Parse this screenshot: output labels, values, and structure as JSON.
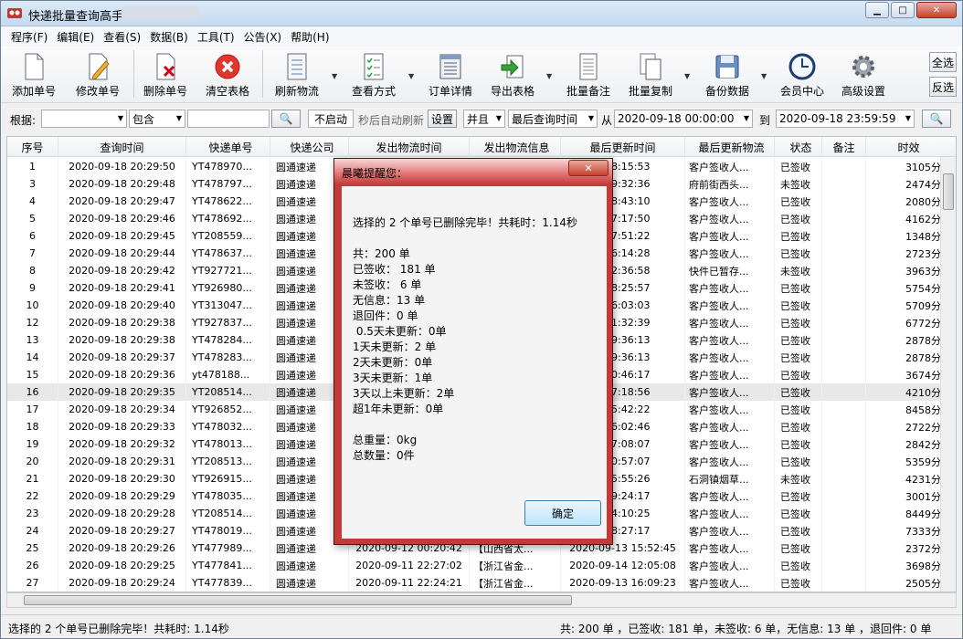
{
  "window": {
    "title": "快递批量查询高手"
  },
  "menu": [
    "程序(F)",
    "编辑(E)",
    "查看(S)",
    "数据(B)",
    "工具(T)",
    "公告(X)",
    "帮助(H)"
  ],
  "toolbar": {
    "add": "添加单号",
    "edit": "修改单号",
    "delete": "删除单号",
    "clear": "清空表格",
    "refresh": "刷新物流",
    "view_mode": "查看方式",
    "order_detail": "订单详情",
    "export": "导出表格",
    "batch_note": "批量备注",
    "batch_copy": "批量复制",
    "backup": "备份数据",
    "member": "会员中心",
    "advanced": "高级设置",
    "select_all": "全选",
    "invert": "反选"
  },
  "filter": {
    "by_label": "根据:",
    "by_value": "",
    "match": "包含",
    "keyword": "",
    "not_started": "不启动",
    "auto_refresh": "秒后自动刷新",
    "set": "设置",
    "logic": "并且",
    "time_field": "最后查询时间",
    "from_label": "从",
    "from": "2020-09-18 00:00:00",
    "to_label": "到",
    "to": "2020-09-18 23:59:59"
  },
  "table": {
    "headers": [
      "序号",
      "查询时间",
      "快递单号",
      "快递公司",
      "发出物流时间",
      "发出物流信息",
      "最后更新时间",
      "最后更新物流",
      "状态",
      "备注",
      "时效"
    ],
    "rows": [
      [
        "1",
        "2020-09-18 20:29:50",
        "YT478970...",
        "圆通速递",
        "",
        "",
        "8 18:15:53",
        "客户签收人...",
        "已签收",
        "",
        "3105分钟"
      ],
      [
        "3",
        "2020-09-18 20:29:48",
        "YT478797...",
        "圆通速递",
        "",
        "",
        "7 09:32:36",
        "府前街西头...",
        "未签收",
        "",
        "2474分钟"
      ],
      [
        "4",
        "2020-09-18 20:29:47",
        "YT478622...",
        "圆通速递",
        "",
        "",
        "6 08:43:10",
        "客户签收人...",
        "已签收",
        "",
        "2080分钟"
      ],
      [
        "5",
        "2020-09-18 20:29:46",
        "YT478692...",
        "圆通速递",
        "",
        "",
        "7 17:17:50",
        "客户签收人...",
        "已签收",
        "",
        "4162分钟"
      ],
      [
        "6",
        "2020-09-18 20:29:45",
        "YT208559...",
        "圆通速递",
        "",
        "",
        "5 17:51:22",
        "客户签收人...",
        "已签收",
        "",
        "1348分钟"
      ],
      [
        "7",
        "2020-09-18 20:29:44",
        "YT478637...",
        "圆通速递",
        "",
        "",
        "6 16:14:28",
        "客户签收人...",
        "已签收",
        "",
        "2723分钟"
      ],
      [
        "8",
        "2020-09-18 20:29:42",
        "YT927721...",
        "圆通速递",
        "",
        "",
        "7 12:36:58",
        "快件已暂存...",
        "未签收",
        "",
        "3963分钟"
      ],
      [
        "9",
        "2020-09-18 20:29:41",
        "YT926980...",
        "圆通速递",
        "",
        "",
        "8 18:25:57",
        "客户签收人...",
        "已签收",
        "",
        "5754分钟"
      ],
      [
        "10",
        "2020-09-18 20:29:40",
        "YT313047...",
        "圆通速递",
        "",
        "",
        "8 16:03:03",
        "客户签收人...",
        "已签收",
        "",
        "5709分钟"
      ],
      [
        "12",
        "2020-09-18 20:29:38",
        "YT927837...",
        "圆通速递",
        "",
        "",
        "8 11:32:39",
        "客户签收人...",
        "已签收",
        "",
        "6772分钟"
      ],
      [
        "13",
        "2020-09-18 20:29:38",
        "YT478284...",
        "圆通速递",
        "",
        "",
        "5 09:36:13",
        "客户签收人...",
        "已签收",
        "",
        "2878分钟"
      ],
      [
        "14",
        "2020-09-18 20:29:37",
        "YT478283...",
        "圆通速递",
        "",
        "",
        "5 09:36:13",
        "客户签收人...",
        "已签收",
        "",
        "2878分钟"
      ],
      [
        "15",
        "2020-09-18 20:29:36",
        "yt478188...",
        "圆通速递",
        "",
        "",
        "5 10:46:17",
        "客户签收人...",
        "已签收",
        "",
        "3674分钟"
      ],
      [
        "16",
        "2020-09-18 20:29:35",
        "YT208514...",
        "圆通速递",
        "",
        "",
        "5 17:18:56",
        "客户签收人...",
        "已签收",
        "",
        "4210分钟"
      ],
      [
        "17",
        "2020-09-18 20:29:34",
        "YT926852...",
        "圆通速递",
        "",
        "",
        "8 15:42:22",
        "客户签收人...",
        "已签收",
        "",
        "8458分钟"
      ],
      [
        "18",
        "2020-09-18 20:29:33",
        "YT478032...",
        "圆通速递",
        "",
        "",
        "4 16:02:46",
        "客户签收人...",
        "已签收",
        "",
        "2722分钟"
      ],
      [
        "19",
        "2020-09-18 20:29:32",
        "YT478013...",
        "圆通速递",
        "",
        "",
        "4 17:08:07",
        "客户签收人...",
        "已签收",
        "",
        "2842分钟"
      ],
      [
        "20",
        "2020-09-18 20:29:31",
        "YT208513...",
        "圆通速递",
        "",
        "",
        "6 10:57:07",
        "客户签收人...",
        "已签收",
        "",
        "5359分钟"
      ],
      [
        "21",
        "2020-09-18 20:29:30",
        "YT926915...",
        "圆通速递",
        "",
        "",
        "5 15:55:26",
        "石洞镇烟草...",
        "未签收",
        "",
        "4231分钟"
      ],
      [
        "22",
        "2020-09-18 20:29:29",
        "YT478035...",
        "圆通速递",
        "",
        "",
        "4 19:24:17",
        "客户签收人...",
        "已签收",
        "",
        "3001分钟"
      ],
      [
        "23",
        "2020-09-18 20:29:28",
        "YT208514...",
        "圆通速递",
        "",
        "",
        "8 14:10:25",
        "客户签收人...",
        "已签收",
        "",
        "8449分钟"
      ],
      [
        "24",
        "2020-09-18 20:29:27",
        "YT478019...",
        "圆通速递",
        "",
        "",
        "7 18:27:17",
        "客户签收人...",
        "已签收",
        "",
        "7333分钟"
      ],
      [
        "25",
        "2020-09-18 20:29:26",
        "YT477989...",
        "圆通速递",
        "2020-09-12 00:20:42",
        "【山西省太...",
        "2020-09-13 15:52:45",
        "客户签收人...",
        "已签收",
        "",
        "2372分钟"
      ],
      [
        "26",
        "2020-09-18 20:29:25",
        "YT477841...",
        "圆通速递",
        "2020-09-11 22:27:02",
        "【浙江省金...",
        "2020-09-14 12:05:08",
        "客户签收人...",
        "已签收",
        "",
        "3698分钟"
      ],
      [
        "27",
        "2020-09-18 20:29:24",
        "YT477839...",
        "圆通速递",
        "2020-09-11 22:24:21",
        "【浙江省金...",
        "2020-09-13 16:09:23",
        "客户签收人...",
        "已签收",
        "",
        "2505分钟"
      ]
    ]
  },
  "dialog": {
    "title": "晨曦提醒您：",
    "message": "选择的 2 个单号已删除完毕！共耗时：1.14秒\n\n共：200 单\n已签收： 181 单\n未签收： 6 单\n无信息：13 单\n退回件：0 单\n 0.5天未更新：0单\n1天未更新：2 单\n2天未更新：0单\n3天未更新：1单\n3天以上未更新：2单\n超1年未更新：0单\n\n总重量：0kg\n总数量：0件",
    "ok": "确定"
  },
  "status": {
    "left": "选择的 2 个单号已删除完毕！共耗时: 1.14秒",
    "right": "共: 200 单 ，已签收:  181 单，未签收:  6 单，无信息: 13 单 ，退回件: 0 单"
  }
}
